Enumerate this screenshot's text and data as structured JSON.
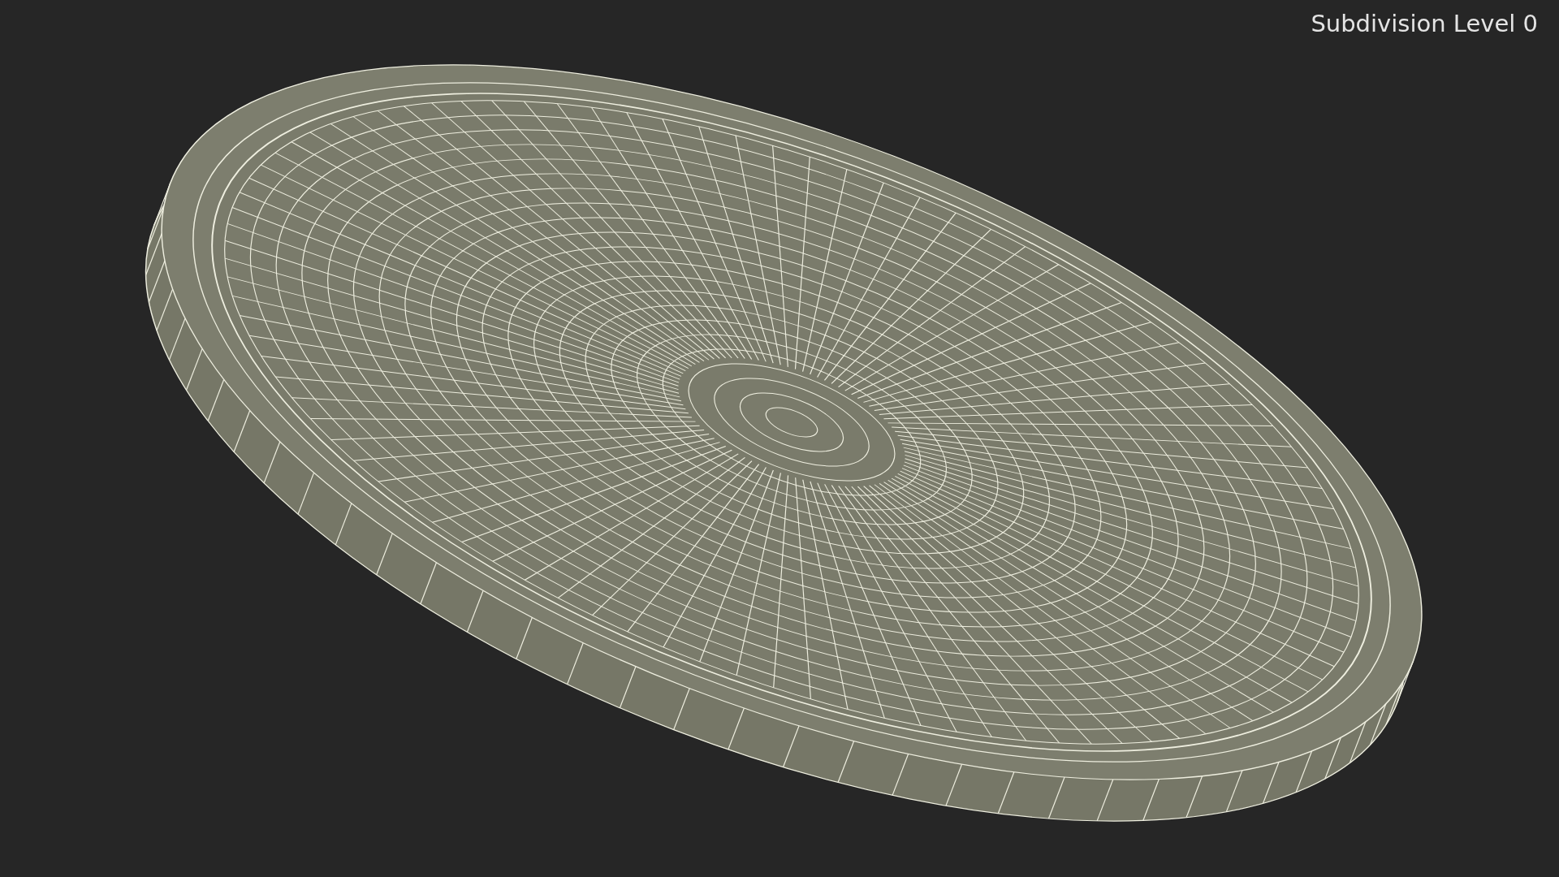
{
  "viewport": {
    "label": "Subdivision Level 0"
  }
}
